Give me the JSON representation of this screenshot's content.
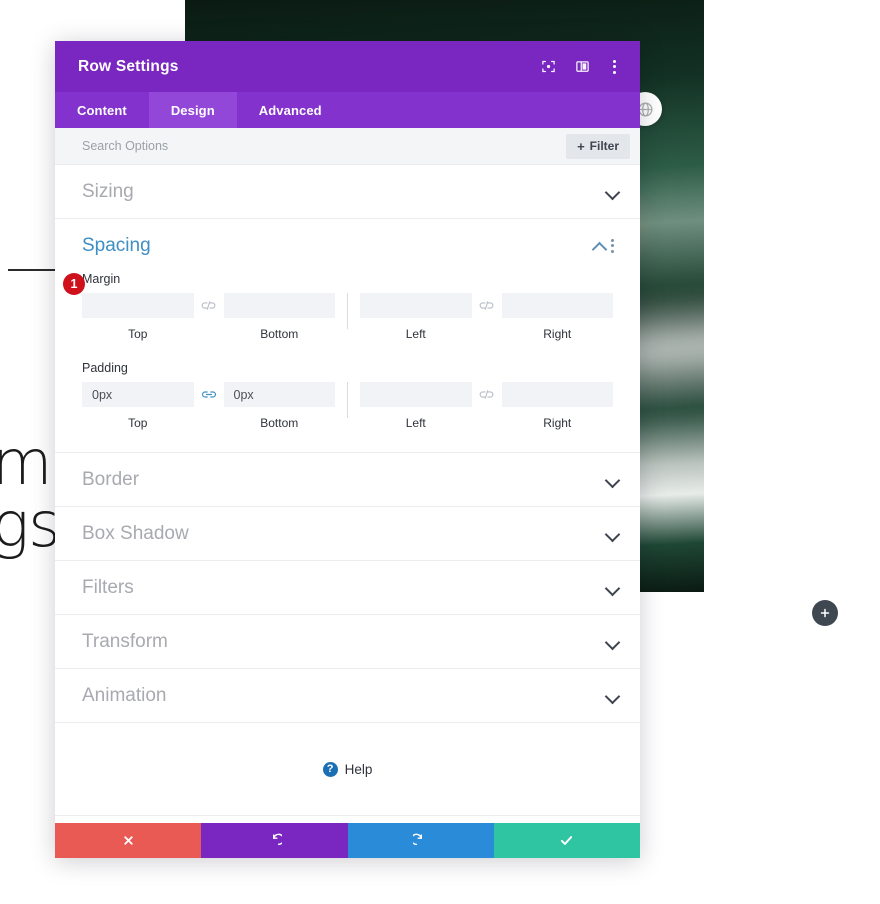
{
  "page": {
    "heading_line1": "ma",
    "heading_line2": "gs",
    "globe_icon": "globe-icon",
    "add_icon": "plus-icon"
  },
  "modal": {
    "title": "Row Settings",
    "header_icons": [
      {
        "name": "focus-target-icon"
      },
      {
        "name": "layout-panel-icon"
      },
      {
        "name": "kebab-menu-icon"
      }
    ],
    "tabs": [
      {
        "label": "Content",
        "active": false
      },
      {
        "label": "Design",
        "active": true
      },
      {
        "label": "Advanced",
        "active": false
      }
    ],
    "search": {
      "placeholder": "Search Options",
      "value": "",
      "filter_label": "Filter",
      "filter_plus": "+"
    },
    "sections": [
      {
        "label": "Sizing",
        "state": "collapsed"
      },
      {
        "label": "Spacing",
        "state": "expanded"
      },
      {
        "label": "Border",
        "state": "collapsed"
      },
      {
        "label": "Box Shadow",
        "state": "collapsed"
      },
      {
        "label": "Filters",
        "state": "collapsed"
      },
      {
        "label": "Transform",
        "state": "collapsed"
      },
      {
        "label": "Animation",
        "state": "collapsed"
      }
    ],
    "spacing": {
      "title": "Spacing",
      "margin": {
        "label": "Margin",
        "top": {
          "caption": "Top",
          "value": "",
          "placeholder": ""
        },
        "bottom": {
          "caption": "Bottom",
          "value": "",
          "placeholder": ""
        },
        "left": {
          "caption": "Left",
          "value": "",
          "placeholder": ""
        },
        "right": {
          "caption": "Right",
          "value": "",
          "placeholder": ""
        },
        "link_tb": "broken-link-icon",
        "link_lr": "broken-link-icon"
      },
      "padding": {
        "label": "Padding",
        "badge": "1",
        "top": {
          "caption": "Top",
          "value": "0px",
          "placeholder": ""
        },
        "bottom": {
          "caption": "Bottom",
          "value": "0px",
          "placeholder": ""
        },
        "left": {
          "caption": "Left",
          "value": "",
          "placeholder": ""
        },
        "right": {
          "caption": "Right",
          "value": "",
          "placeholder": ""
        },
        "link_tb": "linked-link-icon",
        "link_lr": "broken-link-icon"
      }
    },
    "help": {
      "label": "Help",
      "glyph": "?"
    },
    "actions": [
      {
        "name": "cancel-button",
        "icon": "x-icon",
        "color": "#ea5a54"
      },
      {
        "name": "undo-button",
        "icon": "undo-icon",
        "color": "#7a27c1"
      },
      {
        "name": "redo-button",
        "icon": "redo-icon",
        "color": "#2a8bd8"
      },
      {
        "name": "save-button",
        "icon": "check-icon",
        "color": "#30c5a2"
      }
    ]
  },
  "colors": {
    "header_purple": "#7a27c1",
    "tabbar_purple": "#8332cd",
    "tab_active": "#9347d8",
    "section_blue": "#3d8fc4",
    "badge_red": "#cf111b"
  }
}
